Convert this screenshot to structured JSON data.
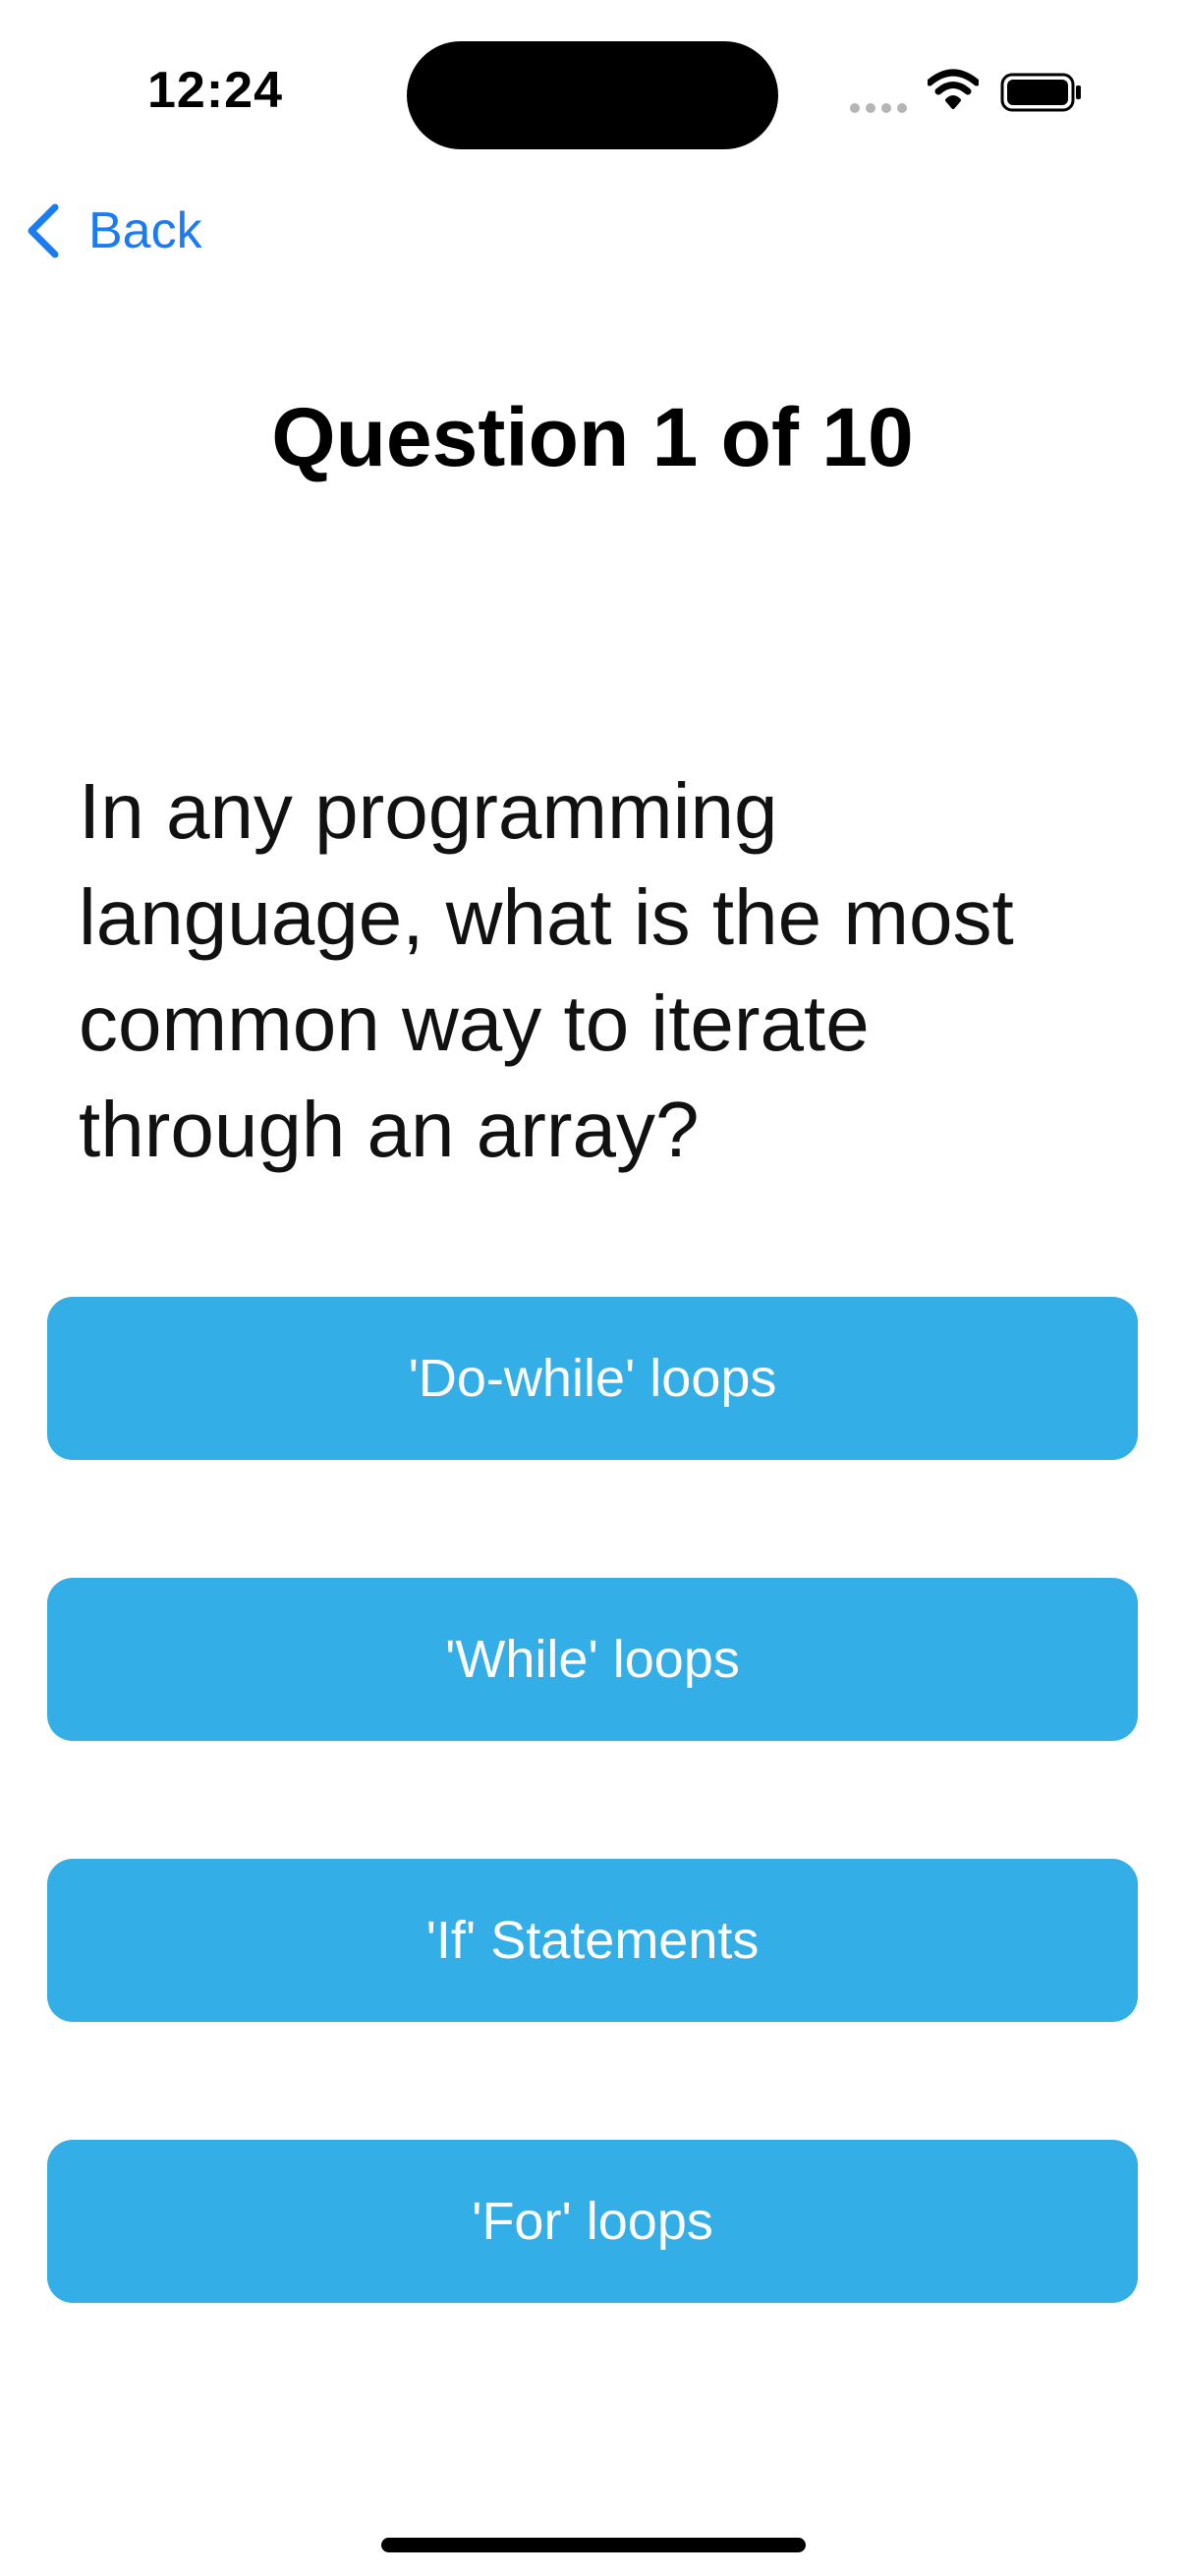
{
  "status_bar": {
    "time": "12:24",
    "icons": [
      "signal-dots-icon",
      "wifi-icon",
      "battery-icon"
    ]
  },
  "nav": {
    "back_label": "Back",
    "back_icon": "chevron-left-icon",
    "accent_color": "#1a7cf0"
  },
  "header": {
    "title": "Question 1 of 10"
  },
  "question": {
    "text": "In any programming language, what is the most common way to iterate through an array?"
  },
  "answers": {
    "button_color": "#33aee6",
    "options": [
      {
        "label": "'Do-while' loops"
      },
      {
        "label": "'While' loops"
      },
      {
        "label": "'If' Statements"
      },
      {
        "label": "'For' loops"
      }
    ]
  }
}
